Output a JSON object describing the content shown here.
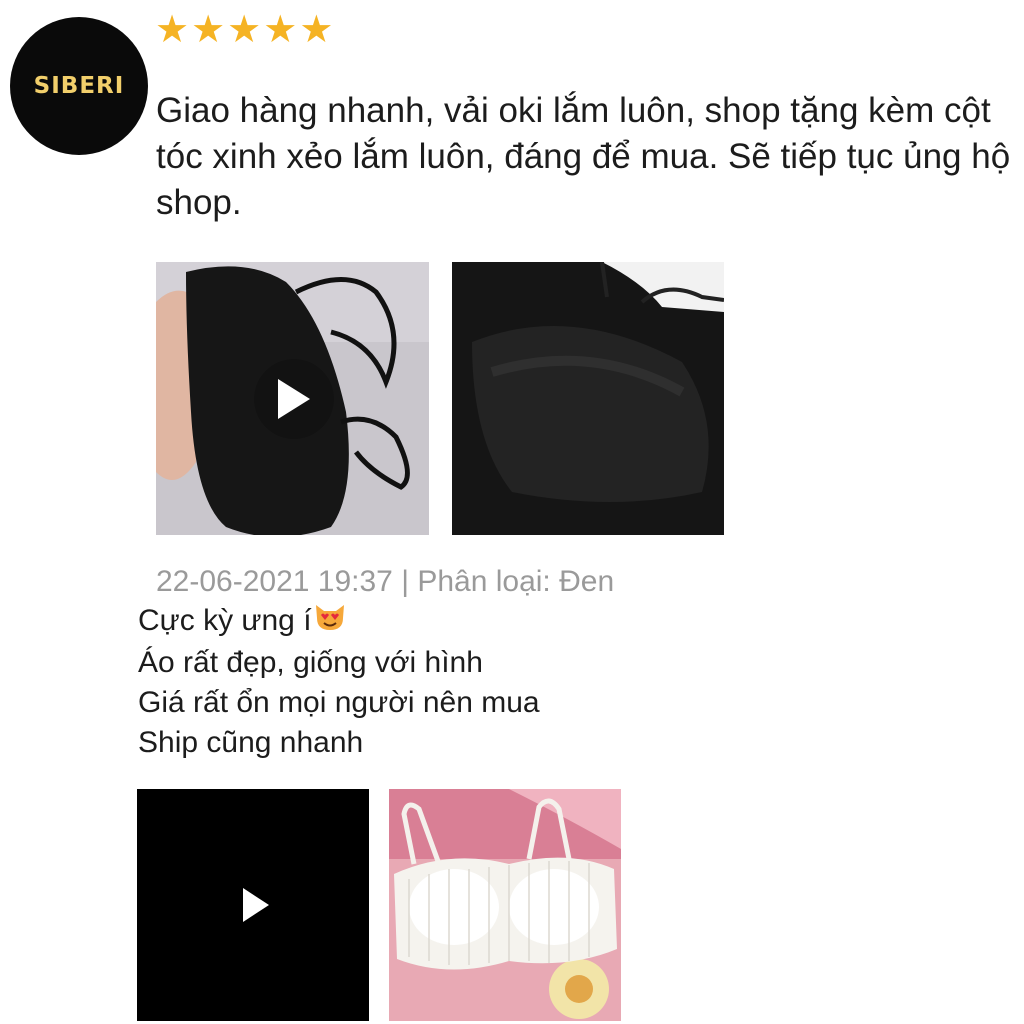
{
  "brand": {
    "logo_text": "SIBERI",
    "logo_text_color": "#f2cf6b",
    "logo_bg": "#0a0a0a"
  },
  "review_one": {
    "rating": 5,
    "stars": [
      "★",
      "★",
      "★",
      "★",
      "★"
    ],
    "star_color": "#f5b324",
    "text": "Giao hàng nhanh, vải oki lắm luôn, shop tặng kèm cột tóc xinh xẻo lắm luôn, đáng để mua. Sẽ tiếp tục ủng hộ shop.",
    "media": [
      {
        "kind": "video",
        "icon": "play-icon"
      },
      {
        "kind": "photo"
      }
    ]
  },
  "review_two": {
    "meta": "22-06-2021 19:37 | Phân loại: Đen",
    "lines": [
      "Cực kỳ ưng í",
      "Áo rất đẹp, giống với hình",
      "Giá rất ổn mọi người nên mua",
      "Ship cũng nhanh"
    ],
    "emoji": "heart-eyes-cat-emoji",
    "media": [
      {
        "kind": "video",
        "icon": "play-icon"
      },
      {
        "kind": "photo"
      }
    ]
  }
}
